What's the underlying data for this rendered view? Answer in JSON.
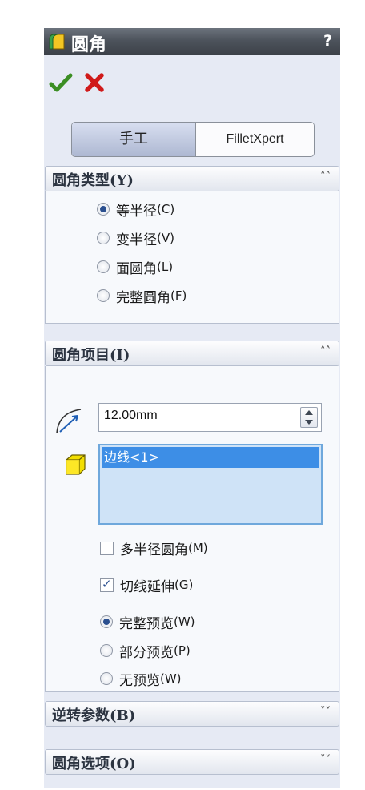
{
  "title": "圆角",
  "help": "?",
  "tabs": {
    "manual": "手工",
    "xpert": "FilletXpert"
  },
  "fillet_type": {
    "header": "圆角类型(Y)",
    "options": [
      {
        "label": "等半径",
        "suffix": "(C)",
        "selected": true
      },
      {
        "label": "变半径",
        "suffix": "(V)",
        "selected": false
      },
      {
        "label": "面圆角",
        "suffix": "(L)",
        "selected": false
      },
      {
        "label": "完整圆角",
        "suffix": "(F)",
        "selected": false
      }
    ]
  },
  "fillet_items": {
    "header": "圆角项目(I)",
    "radius": "12.00mm",
    "edges": [
      "边线<1>"
    ],
    "multi_radius": {
      "label": "多半径圆角",
      "suffix": "(M)",
      "checked": false
    },
    "tangent": {
      "label": "切线延伸",
      "suffix": "(G)",
      "checked": true
    },
    "preview": [
      {
        "label": "完整预览",
        "suffix": "(W)",
        "selected": true
      },
      {
        "label": "部分预览",
        "suffix": "(P)",
        "selected": false
      },
      {
        "label": "无预览",
        "suffix": "(W)",
        "selected": false
      }
    ]
  },
  "setback": {
    "header": "逆转参数(B)"
  },
  "options_group": {
    "header": "圆角选项(O)"
  },
  "colors": {
    "title_bar": "#4d535c",
    "panel": "#e6eaf4",
    "selection": "#3d8ee6",
    "accent": "#2a4f8f"
  }
}
